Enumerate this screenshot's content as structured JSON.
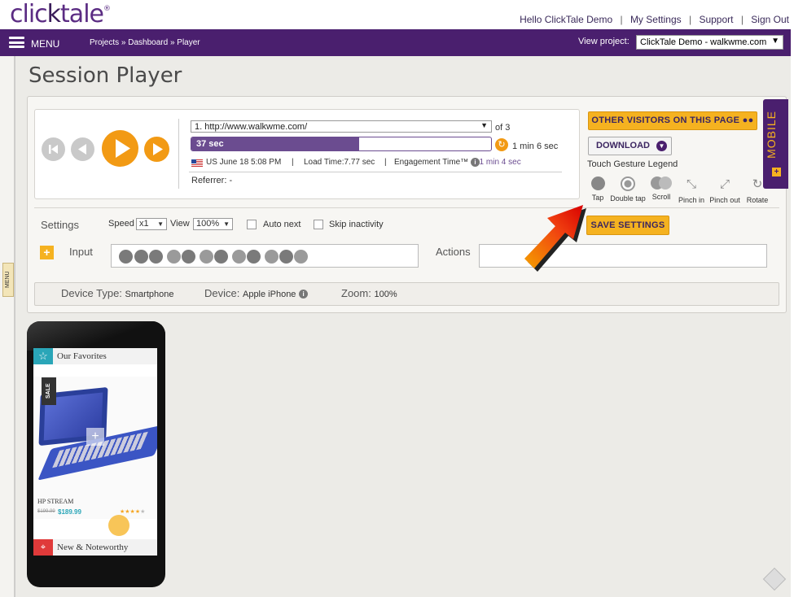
{
  "brand": {
    "logo_text": "clic",
    "logo_text2": "tale",
    "reg": "®"
  },
  "toplinks": {
    "hello": "Hello ClickTale Demo",
    "settings": "My Settings",
    "support": "Support",
    "signout": "Sign Out",
    "sep": "|"
  },
  "nav": {
    "menu": "MENU",
    "breadcrumbs": "Projects » Dashboard » Player",
    "view_project_label": "View project:",
    "project": "ClickTale Demo - walkwme.com"
  },
  "side_menu_tab": "MENU",
  "page_title": "Session Player",
  "player": {
    "page_select": "1. http://www.walkwme.com/",
    "page_of": "of 3",
    "progress_text": "37 sec",
    "progress_fraction": 0.56,
    "duration": "1 min 6 sec",
    "location_time": "US June 18 5:08 PM",
    "load_time": "Load Time:7.77 sec",
    "engagement_label": "Engagement Time™",
    "engagement_value": ": 1 min 4 sec",
    "referrer": "Referrer: -",
    "sep": "|"
  },
  "buttons": {
    "other_visitors": "OTHER VISITORS ON THIS PAGE",
    "download": "DOWNLOAD",
    "save_settings": "SAVE SETTINGS",
    "mobile": "MOBILE"
  },
  "touch_legend": {
    "title": "Touch Gesture Legend",
    "items": [
      "Tap",
      "Double tap",
      "Scroll",
      "Pinch in",
      "Pinch out",
      "Rotate"
    ]
  },
  "settings": {
    "label": "Settings",
    "speed_label": "Speed",
    "speed_value": "x1",
    "view_label": "View",
    "view_value": "100%",
    "auto_next": "Auto next",
    "skip_inactivity": "Skip inactivity",
    "input_label": "Input",
    "actions_label": "Actions"
  },
  "device": {
    "type_label": "Device Type:",
    "type_value": "Smartphone",
    "device_label": "Device:",
    "device_value": "Apple iPhone",
    "zoom_label": "Zoom:",
    "zoom_value": "100%"
  },
  "phone_screen": {
    "favorites": "Our Favorites",
    "sale": "SALE",
    "product_name": "HP STREAM",
    "old_price": "$199.99",
    "new_price": "$189.99",
    "new_noteworthy": "New & Noteworthy",
    "rating": 4
  },
  "colors": {
    "brand_purple": "#4a1f6e",
    "accent_orange": "#f29a14",
    "button_yellow": "#f5b220"
  }
}
